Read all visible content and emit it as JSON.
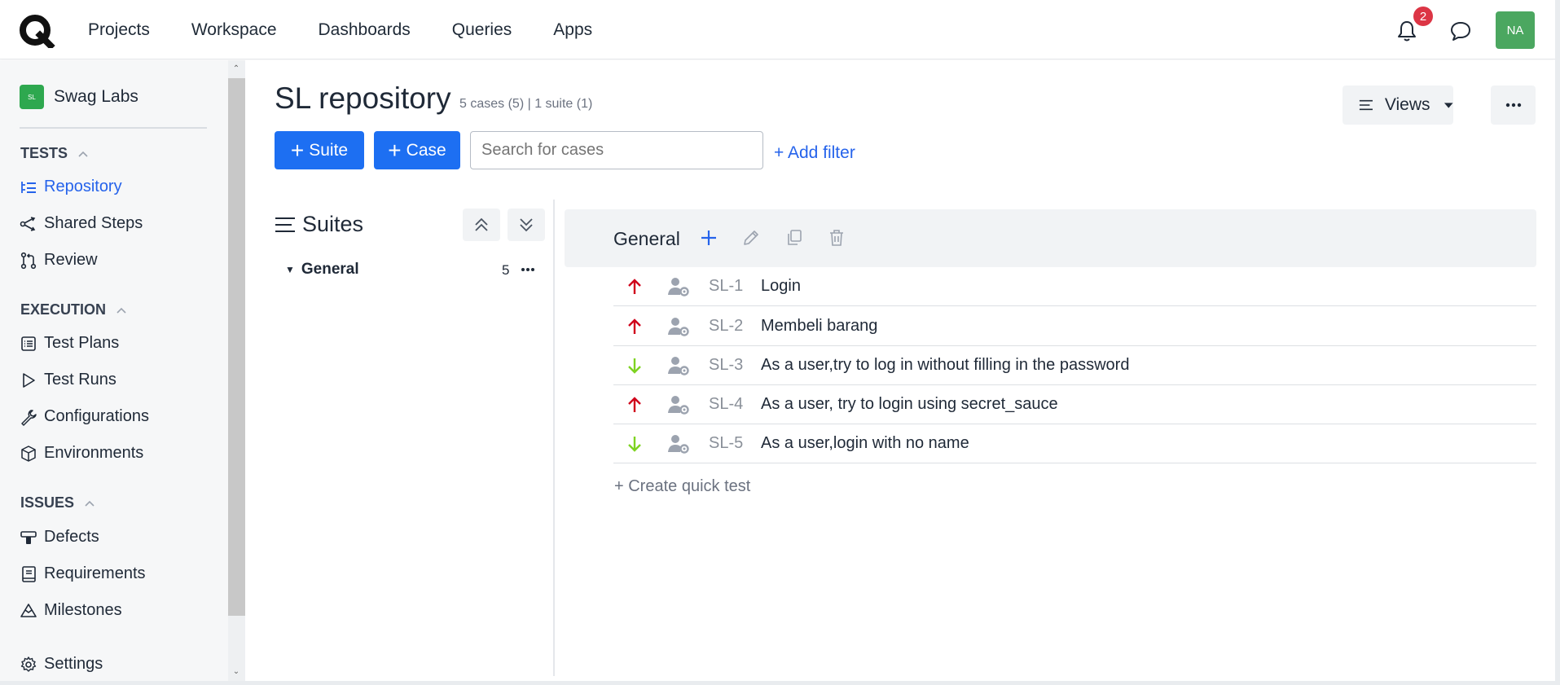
{
  "topbar": {
    "logo_icon": "q-logo",
    "nav": [
      "Projects",
      "Workspace",
      "Dashboards",
      "Queries",
      "Apps"
    ],
    "notifications_count": "2",
    "avatar_initials": "NA",
    "avatar_color": "#4ba760"
  },
  "sidebar": {
    "project_badge": "SL",
    "project_name": "Swag Labs",
    "sections": {
      "tests": "TESTS",
      "execution": "EXECUTION",
      "issues": "ISSUES"
    },
    "items": {
      "repository": "Repository",
      "shared_steps": "Shared Steps",
      "review": "Review",
      "test_plans": "Test Plans",
      "test_runs": "Test Runs",
      "configurations": "Configurations",
      "environments": "Environments",
      "defects": "Defects",
      "requirements": "Requirements",
      "milestones": "Milestones",
      "settings": "Settings"
    }
  },
  "page": {
    "title": "SL repository",
    "meta": "5 cases (5) | 1 suite (1)",
    "suite_button": "Suite",
    "case_button": "Case",
    "search_placeholder": "Search for cases",
    "add_filter": "+ Add filter",
    "views_button": "Views"
  },
  "suites_panel": {
    "title": "Suites",
    "tree": [
      {
        "name": "General",
        "count": "5"
      }
    ]
  },
  "cases_panel": {
    "group_title": "General",
    "cases": [
      {
        "id": "SL-1",
        "title": "Login",
        "priority": "high"
      },
      {
        "id": "SL-2",
        "title": "Membeli barang",
        "priority": "high"
      },
      {
        "id": "SL-3",
        "title": "As a user,try to log in without filling in the password",
        "priority": "low"
      },
      {
        "id": "SL-4",
        "title": "As a user, try to login using secret_sauce",
        "priority": "high"
      },
      {
        "id": "SL-5",
        "title": "As a user,login with no name",
        "priority": "low"
      }
    ],
    "quick_test": "+ Create quick test"
  },
  "colors": {
    "primary": "#1d6ff2",
    "priority_high": "#d0021b",
    "priority_low": "#7ed321",
    "badge": "#dc3545"
  }
}
